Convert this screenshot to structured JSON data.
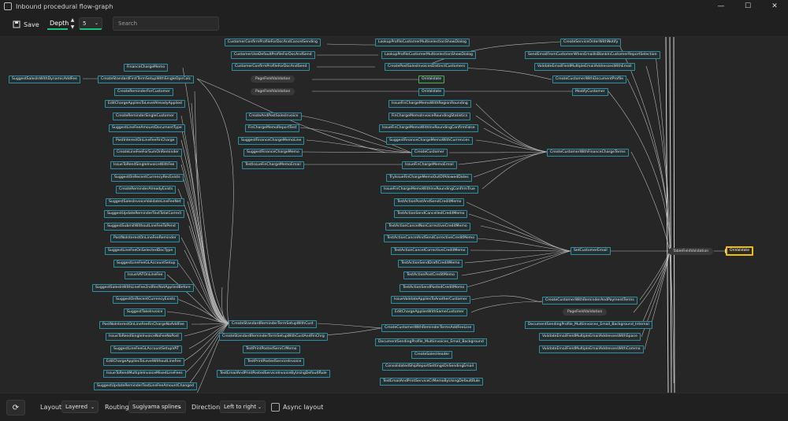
{
  "window": {
    "title": "Inbound procedural flow-graph",
    "controls": {
      "minimize": "—",
      "maximize": "☐",
      "close": "✕"
    }
  },
  "toolbar": {
    "save_label": "Save",
    "depth_label": "Depth",
    "depth_value": "5",
    "search_placeholder": "Search"
  },
  "graph": {
    "nodes": [
      {
        "id": "n1",
        "label": "SuggestSalesInWithDynamicAddFee"
      },
      {
        "id": "n2",
        "label": "CreateStandardFirstTermSetupWithSingleOpnCalc"
      },
      {
        "id": "n3",
        "label": "FinanceChargeMemo"
      },
      {
        "id": "n4",
        "label": "CreateReminderForCustomer"
      },
      {
        "id": "n5",
        "label": "EditChargeAppliesToLevelAlreadyApplied"
      },
      {
        "id": "n6",
        "label": "CreateReminderSingleCustomer"
      },
      {
        "id": "n7",
        "label": "SuggestLineFeeAmountDocumentType"
      },
      {
        "id": "n8",
        "label": "PostInterestOnLineFeeFinCharge"
      },
      {
        "id": "n9",
        "label": "CreateLineFeeForSumOnReminder"
      },
      {
        "id": "n10",
        "label": "IssueToRendSingleInvoiceWithFee"
      },
      {
        "id": "n11",
        "label": "SuggestOnRecentCurrencyRecExists"
      },
      {
        "id": "n12",
        "label": "CreateReminderAlreadyExists"
      },
      {
        "id": "n13",
        "label": "SuggestSalesInvoiceValidateLineFeeNet"
      },
      {
        "id": "n14",
        "label": "SuggestUpdateReminderTextTotalCorrect"
      },
      {
        "id": "n15",
        "label": "SuggestSubmitWithoutLineFeeToPend"
      },
      {
        "id": "n16",
        "label": "PostNoInterestOnLineFeeReminder"
      },
      {
        "id": "n17",
        "label": "SuggestLineFeeOnSelectedDocType"
      },
      {
        "id": "n18",
        "label": "SuggestLineFeeGLAccountSetup"
      },
      {
        "id": "n19",
        "label": "IssueVATOnLineFee"
      },
      {
        "id": "n20",
        "label": "SuggestSalesInWithLineFee2ndRecNotAppliedBefore"
      },
      {
        "id": "n21",
        "label": "SuggestOnRecentCurrencyExists"
      },
      {
        "id": "n22",
        "label": "SuggestTakeInvoice"
      },
      {
        "id": "n23",
        "label": "PostNoInterestOnLineFeeFinChargeNoAddFee"
      },
      {
        "id": "n24",
        "label": "IssueToRendSingleInvoiceNoFeeNoPost"
      },
      {
        "id": "n25",
        "label": "SuggestLineFeeGLAccountSetupVAT"
      },
      {
        "id": "n26",
        "label": "EditChargeAppliesToLevelWithoutLineFee"
      },
      {
        "id": "n27",
        "label": "IssueToRendMultipleInvoiceMixedLineFees"
      },
      {
        "id": "n28",
        "label": "SuggestUpdateReminderTextLineFeeAmountChanged"
      },
      {
        "id": "n29",
        "label": "CreateStandardReminderTermSetupWithCust"
      },
      {
        "id": "n30",
        "label": "CreateStandardReminderTermSetupWithCustAndFinChrg"
      },
      {
        "id": "n31",
        "label": "CustomerConfirmProfileForDocAndCancelSending"
      },
      {
        "id": "n32",
        "label": "CustomerUseDefaultProfileForDocAndSend"
      },
      {
        "id": "n33",
        "label": "CustomerConfirmProfileForDocAndSend"
      },
      {
        "id": "n34",
        "label": "CreateAndPostSalesInvoice"
      },
      {
        "id": "n35",
        "label": "FinChargeMemoReportTest"
      },
      {
        "id": "n36",
        "label": "SuggestFinanceChargeMemoLine"
      },
      {
        "id": "n37",
        "label": "SuggestFinanceChargeMemo"
      },
      {
        "id": "n38",
        "label": "TestIssueFinChargeMemoEmail"
      },
      {
        "id": "n39",
        "label": "LookupProfileCustomerMultiselectionShowDialog"
      },
      {
        "id": "n40",
        "label": "LookupProfileCustomerMultiselectionShowDialog"
      },
      {
        "id": "n41",
        "label": "CreatePostSalesInvoicesDistinctCustomers"
      },
      {
        "id": "n42",
        "label": "OnValidate"
      },
      {
        "id": "n43",
        "label": "OnValidate"
      },
      {
        "id": "n44",
        "label": "IssueFinChargeMemoWithRegionRounding"
      },
      {
        "id": "n45",
        "label": "FinChargeMemoInvoiceRoundingStatistics"
      },
      {
        "id": "n46",
        "label": "IssueFinChargeMemoWithInvRoundingConfirmFalse"
      },
      {
        "id": "n47",
        "label": "SuggestFinanceChargeMemoWithCurrencies"
      },
      {
        "id": "n48",
        "label": "CreateCustomer"
      },
      {
        "id": "n49",
        "label": "IssueFinChargeMemoEmail"
      },
      {
        "id": "n50",
        "label": "TryIssueFinChargeMemoOutOfAllowedDates"
      },
      {
        "id": "n51",
        "label": "IssueFinChargeMemoWithInvRoundingConfirmTrue"
      },
      {
        "id": "n52",
        "label": "TestActionPostAndSendCreditMemo"
      },
      {
        "id": "n53",
        "label": "TestActionSendCancelledCreditMemo"
      },
      {
        "id": "n54",
        "label": "TestActionCancelNonCorrectiveCreditMemo"
      },
      {
        "id": "n55",
        "label": "TestActionCancelAndSendCorrectiveCreditMemo"
      },
      {
        "id": "n56",
        "label": "TestActionCancelCorrectiveCreditMemo"
      },
      {
        "id": "n57",
        "label": "TestActionSendDraftCreditMemo"
      },
      {
        "id": "n58",
        "label": "TestActionPostCreditMemo"
      },
      {
        "id": "n59",
        "label": "TestActionSendPostedCreditMemo"
      },
      {
        "id": "n60",
        "label": "IssueValidateAppliesToAnotherCustomer"
      },
      {
        "id": "n61",
        "label": "EditChargeAppliesWithSameCustomer"
      },
      {
        "id": "n62",
        "label": "CreateCustomerWithReminderTermsAddFeeLine"
      },
      {
        "id": "n63",
        "label": "DocumentSendingProfile_Multiinvoices_Email_Background"
      },
      {
        "id": "n64",
        "label": "CreateSalesHeader"
      },
      {
        "id": "n65",
        "label": "TestPrintPostedServCrMemo"
      },
      {
        "id": "n66",
        "label": "TestPrintPostedServiceInvoice"
      },
      {
        "id": "n67",
        "label": "TestEmailAndPrintPostedServiceInvoiceByUsingDefaultRule"
      },
      {
        "id": "n68",
        "label": "ConsolidatedShipReportSettingsOnSendingEmail"
      },
      {
        "id": "n69",
        "label": "TestEmailAndPrintServiceCrMemoByUsingDefaultRule"
      },
      {
        "id": "n70",
        "label": "CreateServiceOrderWithNotify"
      },
      {
        "id": "n71",
        "label": "SendEmailFromCustomerWhenEmailIsBlankInCustomerReportSelection"
      },
      {
        "id": "n72",
        "label": "ValidateEmailFieldMultipleEmailAddressesWithEmail"
      },
      {
        "id": "n73",
        "label": "CreateCustomerWithDocumentProfile"
      },
      {
        "id": "n74",
        "label": "ModifyCustomer"
      },
      {
        "id": "n75",
        "label": "CreateCustomerWithFinanceChargeTerms"
      },
      {
        "id": "n76",
        "label": "SetCustomerEmail"
      },
      {
        "id": "n77",
        "label": "CreateCustomerWithReminderAndPaymentTerms"
      },
      {
        "id": "n78",
        "label": "DocumentSendingProfile_Multiinvoices_Email_Background_Internal"
      },
      {
        "id": "n79",
        "label": "ValidateEmailFieldMultipleEmailAddressesWithSpace"
      },
      {
        "id": "n80",
        "label": "ValidateEmailFieldMultipleEmailAddressesWithComma"
      },
      {
        "id": "n81",
        "label": "OnValidate"
      }
    ],
    "pills": [
      {
        "id": "p1",
        "label": "PageFieldValidation"
      },
      {
        "id": "p2",
        "label": "PageFieldValidation"
      },
      {
        "id": "p3",
        "label": "PageFieldValidation"
      },
      {
        "id": "p4",
        "label": "TableFieldValidation"
      }
    ]
  },
  "bottombar": {
    "layout_label": "Layout",
    "layout_value": "Layered",
    "routing_label": "Routing",
    "routing_value": "Sugiyama splines",
    "direction_label": "Direction",
    "direction_value": "Left to right",
    "async_label": "Async layout"
  },
  "colors": {
    "node_border": "#2e8fa3",
    "selected_border": "#f0c000",
    "accent": "#19c37d"
  }
}
